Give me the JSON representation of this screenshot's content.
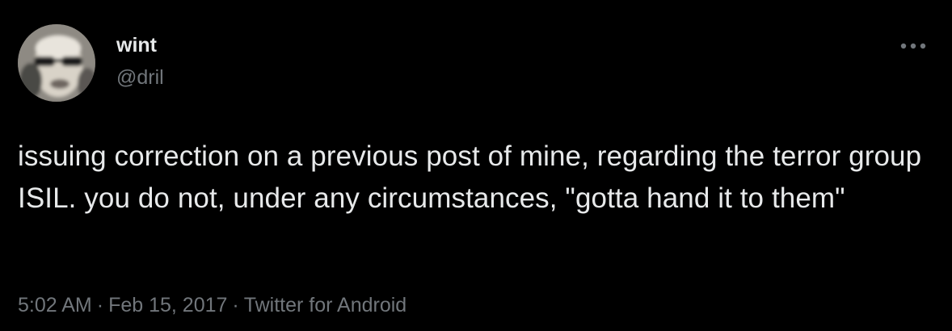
{
  "author": {
    "display_name": "wint",
    "handle": "@dril",
    "avatar_icon": "avatar-photo"
  },
  "tweet": {
    "text": "issuing correction on a previous post of mine, regarding the terror group ISIL. you do not, under any circumstances, \"gotta hand it to them\""
  },
  "meta": {
    "time": "5:02 AM",
    "separator": "·",
    "date": "Feb 15, 2017",
    "source": "Twitter for Android"
  },
  "icons": {
    "more": "more-horizontal-icon"
  },
  "colors": {
    "background": "#000000",
    "primary_text": "#e7e9ea",
    "secondary_text": "#71767b"
  }
}
